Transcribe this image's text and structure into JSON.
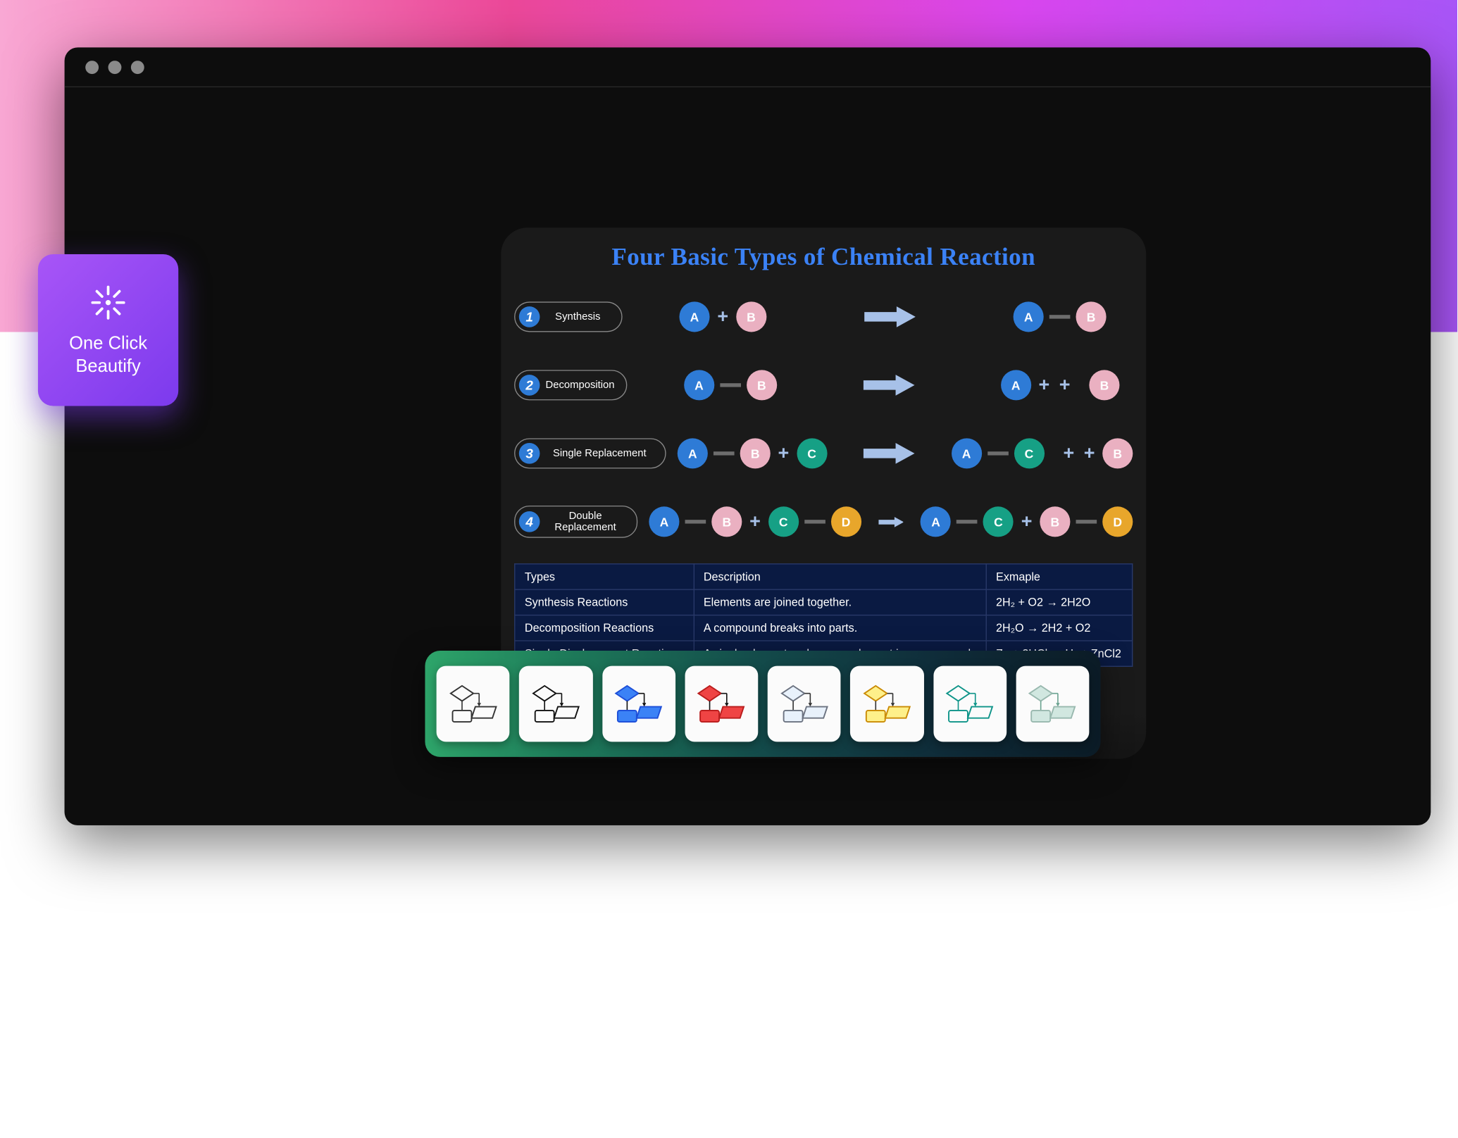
{
  "feature_card": {
    "label": "One Click Beautify"
  },
  "diagram": {
    "title": "Four Basic Types of Chemical Reaction",
    "rows": [
      {
        "num": "1",
        "name": "Synthesis"
      },
      {
        "num": "2",
        "name": "Decomposition"
      },
      {
        "num": "3",
        "name": "Single Replacement"
      },
      {
        "num": "4",
        "name": "Double Replacement"
      }
    ],
    "atoms": {
      "A": "A",
      "B": "B",
      "C": "C",
      "D": "D"
    },
    "plus": "+",
    "table": {
      "headers": [
        "Types",
        "Description",
        "Exmaple"
      ],
      "rows": [
        [
          "Synthesis Reactions",
          "Elements are joined together.",
          "2H₂ + O2 → 2H2O"
        ],
        [
          "Decomposition Reactions",
          "A compound breaks into parts.",
          "2H₂O → 2H2 + O2"
        ],
        [
          "Single Displacement Reactions",
          "A single element replaces an element in a compound.",
          "Zn + 2HCl → H₂ + ZnCl2"
        ]
      ]
    }
  },
  "themes": [
    {
      "name": "outline-white",
      "diamond_fill": "none",
      "diamond_stroke": "#333",
      "rect_fill": "none",
      "rect_stroke": "#333",
      "line": "#333",
      "arrow": "#333"
    },
    {
      "name": "outline-bold",
      "diamond_fill": "none",
      "diamond_stroke": "#111",
      "rect_fill": "none",
      "rect_stroke": "#111",
      "line": "#111",
      "arrow": "#111"
    },
    {
      "name": "blue",
      "diamond_fill": "#3b82f6",
      "diamond_stroke": "#1d4ed8",
      "rect_fill": "#3b82f6",
      "rect_stroke": "#1d4ed8",
      "line": "#111",
      "arrow": "#111"
    },
    {
      "name": "red",
      "diamond_fill": "#ef4444",
      "diamond_stroke": "#b91c1c",
      "rect_fill": "#ef4444",
      "rect_stroke": "#b91c1c",
      "line": "#111",
      "arrow": "#111"
    },
    {
      "name": "sky",
      "diamond_fill": "#e8f1fb",
      "diamond_stroke": "#6b7280",
      "rect_fill": "#e8f1fb",
      "rect_stroke": "#6b7280",
      "line": "#333",
      "arrow": "#333"
    },
    {
      "name": "yellow",
      "diamond_fill": "#fef08a",
      "diamond_stroke": "#ca8a04",
      "rect_fill": "#fef08a",
      "rect_stroke": "#ca8a04",
      "line": "#333",
      "arrow": "#333"
    },
    {
      "name": "teal-outline",
      "diamond_fill": "none",
      "diamond_stroke": "#0d9488",
      "rect_fill": "none",
      "rect_stroke": "#0d9488",
      "line": "#0d9488",
      "arrow": "#0d9488"
    },
    {
      "name": "mint",
      "diamond_fill": "#d1e7e0",
      "diamond_stroke": "#98b8ae",
      "rect_fill": "#d1e7e0",
      "rect_stroke": "#98b8ae",
      "line": "#6aa290",
      "arrow": "#6aa290"
    }
  ]
}
